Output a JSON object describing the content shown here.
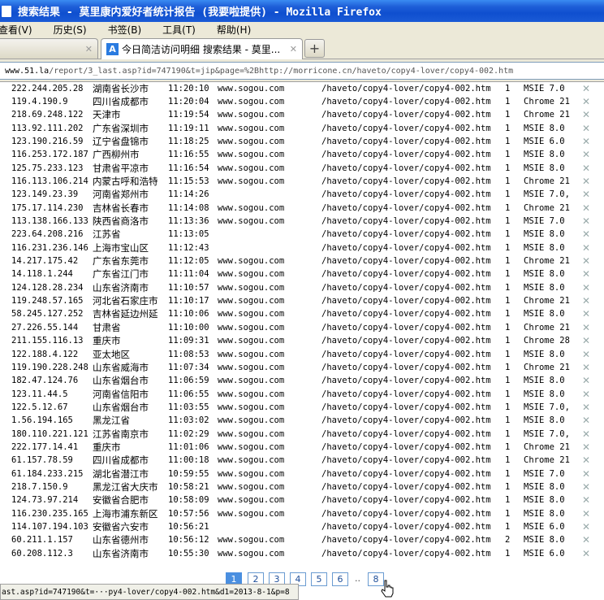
{
  "window": {
    "title": "搜索结果 - 莫里康内爱好者统计报告 (我要啦提供) - Mozilla Firefox"
  },
  "menu": {
    "items": [
      "查看(V)",
      "历史(S)",
      "书签(B)",
      "工具(T)",
      "帮助(H)"
    ]
  },
  "tabs": [
    {
      "label": "",
      "close": "✕"
    },
    {
      "label": "今日简洁访问明细 搜索结果 - 莫里...",
      "favicon": "A",
      "close": "✕"
    }
  ],
  "newtab_label": "+",
  "url": {
    "host": "www.51.la",
    "path": "/report/3_last.asp?id=747190&t=jip&page=%2Bhttp://morricone.cn/haveto/copy4-lover/copy4-002.htm"
  },
  "rows": [
    {
      "ip": "222.244.205.28",
      "loc": "湖南省长沙市",
      "time": "11:20:10",
      "src": "www.sogou.com",
      "page": "/haveto/copy4-lover/copy4-002.htm",
      "cnt": "1",
      "br": "MSIE 7.0"
    },
    {
      "ip": "119.4.190.9",
      "loc": "四川省成都市",
      "time": "11:20:04",
      "src": "www.sogou.com",
      "page": "/haveto/copy4-lover/copy4-002.htm",
      "cnt": "1",
      "br": "Chrome 21"
    },
    {
      "ip": "218.69.248.122",
      "loc": "天津市",
      "time": "11:19:54",
      "src": "www.sogou.com",
      "page": "/haveto/copy4-lover/copy4-002.htm",
      "cnt": "1",
      "br": "Chrome 21"
    },
    {
      "ip": "113.92.111.202",
      "loc": "广东省深圳市",
      "time": "11:19:11",
      "src": "www.sogou.com",
      "page": "/haveto/copy4-lover/copy4-002.htm",
      "cnt": "1",
      "br": "MSIE 8.0"
    },
    {
      "ip": "123.190.216.59",
      "loc": "辽宁省盘锦市",
      "time": "11:18:25",
      "src": "www.sogou.com",
      "page": "/haveto/copy4-lover/copy4-002.htm",
      "cnt": "1",
      "br": "MSIE 6.0"
    },
    {
      "ip": "116.253.172.187",
      "loc": "广西柳州市",
      "time": "11:16:55",
      "src": "www.sogou.com",
      "page": "/haveto/copy4-lover/copy4-002.htm",
      "cnt": "1",
      "br": "MSIE 8.0"
    },
    {
      "ip": "125.75.233.123",
      "loc": "甘肃省平凉市",
      "time": "11:16:54",
      "src": "www.sogou.com",
      "page": "/haveto/copy4-lover/copy4-002.htm",
      "cnt": "1",
      "br": "MSIE 8.0"
    },
    {
      "ip": "116.113.106.214",
      "loc": "内蒙古呼和浩特",
      "time": "11:15:53",
      "src": "www.sogou.com",
      "page": "/haveto/copy4-lover/copy4-002.htm",
      "cnt": "1",
      "br": "Chrome 21"
    },
    {
      "ip": "123.149.23.39",
      "loc": "河南省郑州市",
      "time": "11:14:26",
      "src": "",
      "page": "/haveto/copy4-lover/copy4-002.htm",
      "cnt": "1",
      "br": "MSIE 7.0,"
    },
    {
      "ip": "175.17.114.230",
      "loc": "吉林省长春市",
      "time": "11:14:08",
      "src": "www.sogou.com",
      "page": "/haveto/copy4-lover/copy4-002.htm",
      "cnt": "1",
      "br": "Chrome 21"
    },
    {
      "ip": "113.138.166.133",
      "loc": "陕西省商洛市",
      "time": "11:13:36",
      "src": "www.sogou.com",
      "page": "/haveto/copy4-lover/copy4-002.htm",
      "cnt": "1",
      "br": "MSIE 7.0"
    },
    {
      "ip": "223.64.208.216",
      "loc": "江苏省",
      "time": "11:13:05",
      "src": "",
      "page": "/haveto/copy4-lover/copy4-002.htm",
      "cnt": "1",
      "br": "MSIE 8.0"
    },
    {
      "ip": "116.231.236.146",
      "loc": "上海市宝山区",
      "time": "11:12:43",
      "src": "",
      "page": "/haveto/copy4-lover/copy4-002.htm",
      "cnt": "1",
      "br": "MSIE 8.0"
    },
    {
      "ip": "14.217.175.42",
      "loc": "广东省东莞市",
      "time": "11:12:05",
      "src": "www.sogou.com",
      "page": "/haveto/copy4-lover/copy4-002.htm",
      "cnt": "1",
      "br": "Chrome 21"
    },
    {
      "ip": "14.118.1.244",
      "loc": "广东省江门市",
      "time": "11:11:04",
      "src": "www.sogou.com",
      "page": "/haveto/copy4-lover/copy4-002.htm",
      "cnt": "1",
      "br": "MSIE 8.0"
    },
    {
      "ip": "124.128.28.234",
      "loc": "山东省济南市",
      "time": "11:10:57",
      "src": "www.sogou.com",
      "page": "/haveto/copy4-lover/copy4-002.htm",
      "cnt": "1",
      "br": "MSIE 8.0"
    },
    {
      "ip": "119.248.57.165",
      "loc": "河北省石家庄市",
      "time": "11:10:17",
      "src": "www.sogou.com",
      "page": "/haveto/copy4-lover/copy4-002.htm",
      "cnt": "1",
      "br": "Chrome 21"
    },
    {
      "ip": "58.245.127.252",
      "loc": "吉林省延边州延",
      "time": "11:10:06",
      "src": "www.sogou.com",
      "page": "/haveto/copy4-lover/copy4-002.htm",
      "cnt": "1",
      "br": "MSIE 8.0"
    },
    {
      "ip": "27.226.55.144",
      "loc": "甘肃省",
      "time": "11:10:00",
      "src": "www.sogou.com",
      "page": "/haveto/copy4-lover/copy4-002.htm",
      "cnt": "1",
      "br": "Chrome 21"
    },
    {
      "ip": "211.155.116.13",
      "loc": "重庆市",
      "time": "11:09:31",
      "src": "www.sogou.com",
      "page": "/haveto/copy4-lover/copy4-002.htm",
      "cnt": "1",
      "br": "Chrome 28"
    },
    {
      "ip": "122.188.4.122",
      "loc": "亚太地区",
      "time": "11:08:53",
      "src": "www.sogou.com",
      "page": "/haveto/copy4-lover/copy4-002.htm",
      "cnt": "1",
      "br": "MSIE 8.0"
    },
    {
      "ip": "119.190.228.248",
      "loc": "山东省威海市",
      "time": "11:07:34",
      "src": "www.sogou.com",
      "page": "/haveto/copy4-lover/copy4-002.htm",
      "cnt": "1",
      "br": "Chrome 21"
    },
    {
      "ip": "182.47.124.76",
      "loc": "山东省烟台市",
      "time": "11:06:59",
      "src": "www.sogou.com",
      "page": "/haveto/copy4-lover/copy4-002.htm",
      "cnt": "1",
      "br": "MSIE 8.0"
    },
    {
      "ip": "123.11.44.5",
      "loc": "河南省信阳市",
      "time": "11:06:55",
      "src": "www.sogou.com",
      "page": "/haveto/copy4-lover/copy4-002.htm",
      "cnt": "1",
      "br": "MSIE 8.0"
    },
    {
      "ip": "122.5.12.67",
      "loc": "山东省烟台市",
      "time": "11:03:55",
      "src": "www.sogou.com",
      "page": "/haveto/copy4-lover/copy4-002.htm",
      "cnt": "1",
      "br": "MSIE 7.0,"
    },
    {
      "ip": "1.56.194.165",
      "loc": "黑龙江省",
      "time": "11:03:02",
      "src": "www.sogou.com",
      "page": "/haveto/copy4-lover/copy4-002.htm",
      "cnt": "1",
      "br": "MSIE 8.0"
    },
    {
      "ip": "180.110.221.121",
      "loc": "江苏省南京市",
      "time": "11:02:29",
      "src": "www.sogou.com",
      "page": "/haveto/copy4-lover/copy4-002.htm",
      "cnt": "1",
      "br": "MSIE 7.0,"
    },
    {
      "ip": "222.177.14.41",
      "loc": "重庆市",
      "time": "11:01:06",
      "src": "www.sogou.com",
      "page": "/haveto/copy4-lover/copy4-002.htm",
      "cnt": "1",
      "br": "Chrome 21"
    },
    {
      "ip": "61.157.78.59",
      "loc": "四川省成都市",
      "time": "11:00:18",
      "src": "www.sogou.com",
      "page": "/haveto/copy4-lover/copy4-002.htm",
      "cnt": "1",
      "br": "Chrome 21"
    },
    {
      "ip": "61.184.233.215",
      "loc": "湖北省潜江市",
      "time": "10:59:55",
      "src": "www.sogou.com",
      "page": "/haveto/copy4-lover/copy4-002.htm",
      "cnt": "1",
      "br": "MSIE 7.0"
    },
    {
      "ip": "218.7.150.9",
      "loc": "黑龙江省大庆市",
      "time": "10:58:21",
      "src": "www.sogou.com",
      "page": "/haveto/copy4-lover/copy4-002.htm",
      "cnt": "1",
      "br": "MSIE 8.0"
    },
    {
      "ip": "124.73.97.214",
      "loc": "安徽省合肥市",
      "time": "10:58:09",
      "src": "www.sogou.com",
      "page": "/haveto/copy4-lover/copy4-002.htm",
      "cnt": "1",
      "br": "MSIE 8.0"
    },
    {
      "ip": "116.230.235.165",
      "loc": "上海市浦东新区",
      "time": "10:57:56",
      "src": "www.sogou.com",
      "page": "/haveto/copy4-lover/copy4-002.htm",
      "cnt": "1",
      "br": "MSIE 8.0"
    },
    {
      "ip": "114.107.194.103",
      "loc": "安徽省六安市",
      "time": "10:56:21",
      "src": "",
      "page": "/haveto/copy4-lover/copy4-002.htm",
      "cnt": "1",
      "br": "MSIE 6.0"
    },
    {
      "ip": "60.211.1.157",
      "loc": "山东省德州市",
      "time": "10:56:12",
      "src": "www.sogou.com",
      "page": "/haveto/copy4-lover/copy4-002.htm",
      "cnt": "2",
      "br": "MSIE 8.0"
    },
    {
      "ip": "60.208.112.3",
      "loc": "山东省济南市",
      "time": "10:55:30",
      "src": "www.sogou.com",
      "page": "/haveto/copy4-lover/copy4-002.htm",
      "cnt": "1",
      "br": "MSIE 6.0"
    }
  ],
  "row_delete_glyph": "✕",
  "pager": {
    "pages": [
      "1",
      "2",
      "3",
      "4",
      "5",
      "6"
    ],
    "current": "1",
    "ellipsis": "..",
    "last": "8"
  },
  "status": {
    "text": "ast.asp?id=747190&t=···py4-lover/copy4-002.htm&d1=2013-8-1&p=8"
  }
}
